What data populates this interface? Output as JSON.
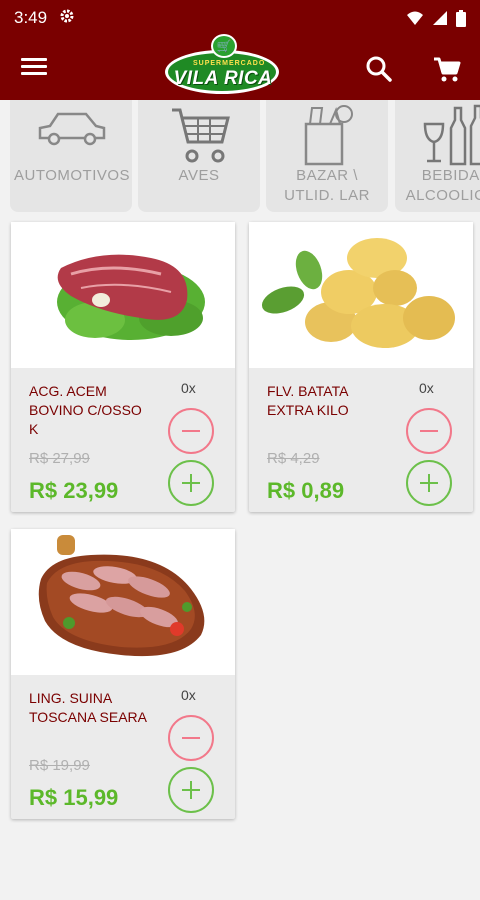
{
  "status": {
    "time": "3:49",
    "icons": [
      "gear-icon",
      "wifi-icon",
      "signal-icon",
      "battery-icon"
    ]
  },
  "appbar": {
    "menu_icon": "menu-icon",
    "logo": {
      "subtitle": "SUPERMERCADO",
      "name": "VILA RICA"
    },
    "search_icon": "search-icon",
    "cart_icon": "cart-icon",
    "color": "#7a0000"
  },
  "categories": [
    {
      "label": "AUTOMOTIVOS",
      "icon": "car-icon"
    },
    {
      "label": "AVES",
      "icon": "shopping-cart-icon"
    },
    {
      "label": "BAZAR \\ UTLID. LAR",
      "icon": "grocery-bag-icon"
    },
    {
      "label": "BEBIDAS ALCOOLICAS",
      "icon": "wine-bottle-icon"
    }
  ],
  "products": [
    {
      "name": "ACG. ACEM BOVINO C/OSSO K",
      "qty": "0x",
      "old_price": "R$ 27,99",
      "price": "R$ 23,99",
      "image": "beef-image"
    },
    {
      "name": "FLV. BATATA EXTRA KILO",
      "qty": "0x",
      "old_price": "R$ 4,29",
      "price": "R$ 0,89",
      "image": "potato-image"
    },
    {
      "name": "LING. SUINA TOSCANA SEARA",
      "qty": "0x",
      "old_price": "R$ 19,99",
      "price": "R$ 15,99",
      "image": "sausage-image"
    }
  ],
  "colors": {
    "price": "#5cb82a",
    "minus": "#f2788a",
    "plus": "#6cc04a",
    "name": "#7a0000"
  }
}
